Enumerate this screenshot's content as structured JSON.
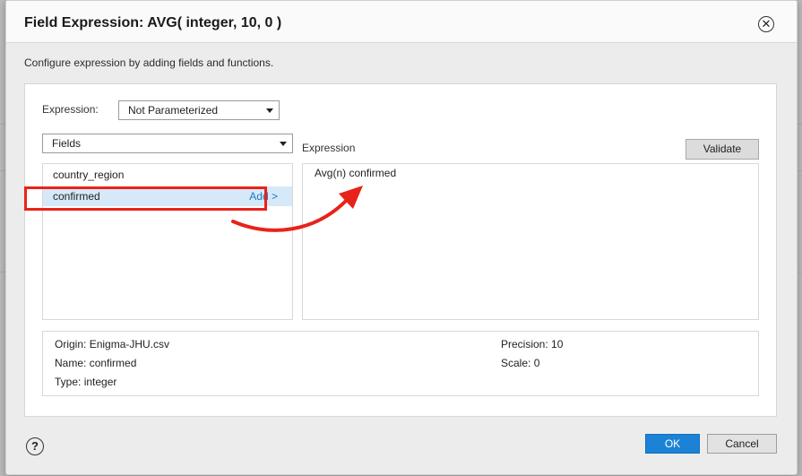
{
  "dialog": {
    "title": "Field Expression: AVG( integer, 10, 0 )",
    "subtitle": "Configure expression by adding fields and functions."
  },
  "expression_mode": {
    "label": "Expression:",
    "selected": "Not Parameterized"
  },
  "fields_dropdown": {
    "selected": "Fields"
  },
  "field_list": {
    "items": [
      {
        "name": "country_region",
        "selected": false
      },
      {
        "name": "confirmed",
        "selected": true,
        "action": "Add >"
      }
    ]
  },
  "expression_editor": {
    "label": "Expression",
    "validate_label": "Validate",
    "text": "Avg(n) confirmed"
  },
  "field_info": {
    "origin_label": "Origin:",
    "origin": "Enigma-JHU.csv",
    "name_label": "Name:",
    "name": "confirmed",
    "type_label": "Type:",
    "type": "integer",
    "precision_label": "Precision:",
    "precision": "10",
    "scale_label": "Scale:",
    "scale": "0"
  },
  "footer": {
    "ok_label": "OK",
    "cancel_label": "Cancel"
  },
  "icons": {
    "close": "close-icon",
    "help": "help-icon",
    "caret": "caret-down-icon"
  },
  "colors": {
    "accent": "#1b82d6",
    "annotation": "#e8231a",
    "selection": "#d6e9f8"
  }
}
